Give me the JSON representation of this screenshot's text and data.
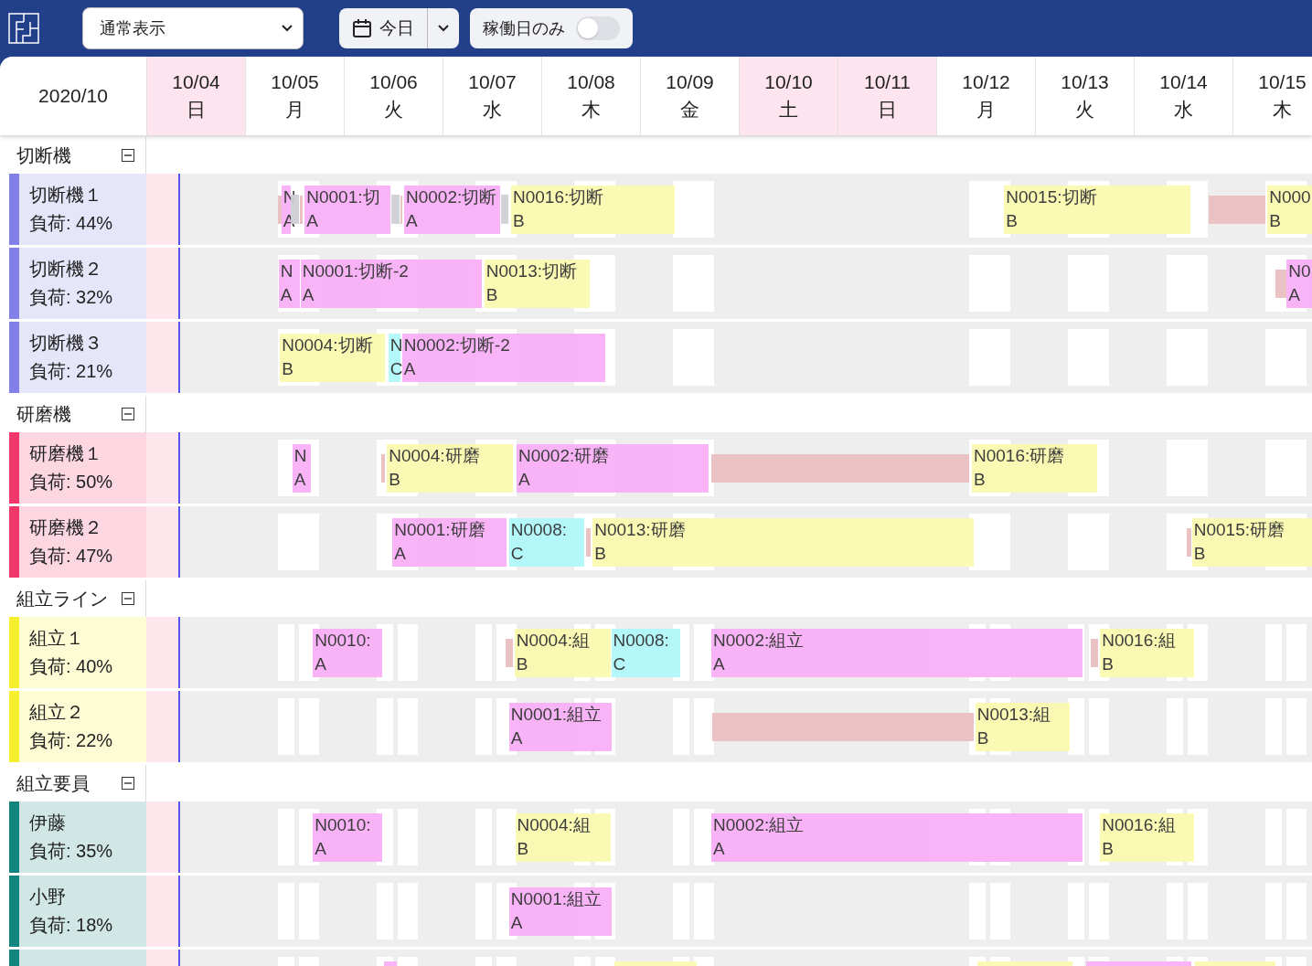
{
  "toolbar": {
    "view_select": {
      "value": "通常表示"
    },
    "today_button": {
      "label": "今日"
    },
    "workdays_toggle": {
      "label": "稼働日のみ",
      "on": false
    }
  },
  "timeline": {
    "month": "2020/10",
    "days": [
      {
        "date": "10/04",
        "weekday": "日",
        "holiday": true
      },
      {
        "date": "10/05",
        "weekday": "月",
        "holiday": false
      },
      {
        "date": "10/06",
        "weekday": "火",
        "holiday": false
      },
      {
        "date": "10/07",
        "weekday": "水",
        "holiday": false
      },
      {
        "date": "10/08",
        "weekday": "木",
        "holiday": false
      },
      {
        "date": "10/09",
        "weekday": "金",
        "holiday": false
      },
      {
        "date": "10/10",
        "weekday": "土",
        "holiday": true
      },
      {
        "date": "10/11",
        "weekday": "日",
        "holiday": true
      },
      {
        "date": "10/12",
        "weekday": "月",
        "holiday": false
      },
      {
        "date": "10/13",
        "weekday": "火",
        "holiday": false
      },
      {
        "date": "10/14",
        "weekday": "水",
        "holiday": false
      },
      {
        "date": "10/15",
        "weekday": "木",
        "holiday": false
      }
    ]
  },
  "groups": [
    {
      "name": "切断機",
      "expanded": true,
      "kind": "day",
      "color": "#8080e8",
      "resources": [
        {
          "name": "切断機１",
          "load": "負荷: 44%",
          "bars": [
            {
              "kind": "setup",
              "color": "#e9bfc0"
            },
            {
              "kind": "job",
              "label": "N",
              "category": "A",
              "color": "#f9b0f8"
            },
            {
              "kind": "wait",
              "color": "#cfcfd6"
            },
            {
              "kind": "setup",
              "color": "#e9bfc0"
            },
            {
              "kind": "job",
              "label": "N0001:切",
              "category": "A",
              "color": "#f9b0f8"
            },
            {
              "kind": "wait",
              "color": "#cfcfd6"
            },
            {
              "kind": "setup",
              "color": "#e9bfc0"
            },
            {
              "kind": "job",
              "label": "N0002:切断",
              "category": "A",
              "color": "#f9b0f8"
            },
            {
              "kind": "wait",
              "color": "#cfcfd6"
            },
            {
              "kind": "job",
              "label": "N0016:切断",
              "category": "B",
              "color": "#fafab0"
            },
            {
              "kind": "job",
              "label": "N0015:切断",
              "category": "B",
              "color": "#fafab0"
            },
            {
              "kind": "setup",
              "color": "#e9bfc0"
            },
            {
              "kind": "job",
              "label": "N000",
              "category": "B",
              "color": "#fafab0"
            }
          ]
        },
        {
          "name": "切断機２",
          "load": "負荷: 32%",
          "bars": [
            {
              "kind": "job",
              "label": "N",
              "category": "A",
              "color": "#f9b0f8"
            },
            {
              "kind": "job",
              "label": "N0001:切断-2",
              "category": "A",
              "color": "#f9b0f8"
            },
            {
              "kind": "job",
              "label": "N0013:切断",
              "category": "B",
              "color": "#fafab0"
            },
            {
              "kind": "setup",
              "color": "#e9bfc0"
            },
            {
              "kind": "job",
              "label": "N0",
              "category": "A",
              "color": "#f9b0f8"
            }
          ]
        },
        {
          "name": "切断機３",
          "load": "負荷: 21%",
          "bars": [
            {
              "kind": "job",
              "label": "N0004:切断",
              "category": "B",
              "color": "#fafab0"
            },
            {
              "kind": "job",
              "label": "N",
              "category": "C",
              "color": "#b0f8fa"
            },
            {
              "kind": "job",
              "label": "N0002:切断-2",
              "category": "A",
              "color": "#f9b0f8"
            }
          ]
        }
      ]
    },
    {
      "name": "研磨機",
      "expanded": true,
      "kind": "day",
      "color": "#f0386b",
      "resources": [
        {
          "name": "研磨機１",
          "load": "負荷: 50%",
          "bars": [
            {
              "kind": "job",
              "label": "N",
              "category": "A",
              "color": "#f9b0f8"
            },
            {
              "kind": "setup",
              "color": "#e9bfc0"
            },
            {
              "kind": "job",
              "label": "N0004:研磨",
              "category": "B",
              "color": "#fafab0"
            },
            {
              "kind": "job",
              "label": "N0002:研磨",
              "category": "A",
              "color": "#f9b0f8"
            },
            {
              "kind": "setup",
              "color": "#e9bfc0"
            },
            {
              "kind": "job",
              "label": "N0016:研磨",
              "category": "B",
              "color": "#fafab0"
            }
          ]
        },
        {
          "name": "研磨機２",
          "load": "負荷: 47%",
          "bars": [
            {
              "kind": "job",
              "label": "N0001:研磨",
              "category": "A",
              "color": "#f9b0f8"
            },
            {
              "kind": "job",
              "label": "N0008:",
              "category": "C",
              "color": "#b0f8fa"
            },
            {
              "kind": "setup",
              "color": "#e9bfc0"
            },
            {
              "kind": "job",
              "label": "N0013:研磨",
              "category": "B",
              "color": "#fafab0"
            },
            {
              "kind": "setup",
              "color": "#e9bfc0"
            },
            {
              "kind": "job",
              "label": "N0015:研磨",
              "category": "B",
              "color": "#fafab0"
            }
          ]
        }
      ]
    },
    {
      "name": "組立ライン",
      "expanded": true,
      "kind": "shift",
      "color": "#f5ef2e",
      "resources": [
        {
          "name": "組立１",
          "load": "負荷: 40%",
          "bars": [
            {
              "kind": "job",
              "label": "N0010:",
              "category": "A",
              "color": "#f9b0f8"
            },
            {
              "kind": "setup",
              "color": "#e9bfc0"
            },
            {
              "kind": "job",
              "label": "N0004:組",
              "category": "B",
              "color": "#fafab0"
            },
            {
              "kind": "job",
              "label": "N0008:",
              "category": "C",
              "color": "#b0f8fa"
            },
            {
              "kind": "job",
              "label": "N0002:組立",
              "category": "A",
              "color": "#f9b0f8"
            },
            {
              "kind": "setup",
              "color": "#e9bfc0"
            },
            {
              "kind": "job",
              "label": "N0016:組",
              "category": "B",
              "color": "#fafab0"
            }
          ]
        },
        {
          "name": "組立２",
          "load": "負荷: 22%",
          "bars": [
            {
              "kind": "job",
              "label": "N0001:組立",
              "category": "A",
              "color": "#f9b0f8"
            },
            {
              "kind": "setup",
              "color": "#e9bfc0"
            },
            {
              "kind": "job",
              "label": "N0013:組",
              "category": "B",
              "color": "#fafab0"
            }
          ]
        }
      ]
    },
    {
      "name": "組立要員",
      "expanded": true,
      "kind": "shift",
      "color": "#12857c",
      "resources": [
        {
          "name": "伊藤",
          "load": "負荷: 35%",
          "bars": [
            {
              "kind": "job",
              "label": "N0010:",
              "category": "A",
              "color": "#f9b0f8"
            },
            {
              "kind": "job",
              "label": "N0004:組",
              "category": "B",
              "color": "#fafab0"
            },
            {
              "kind": "job",
              "label": "N0002:組立",
              "category": "A",
              "color": "#f9b0f8"
            },
            {
              "kind": "job",
              "label": "N0016:組",
              "category": "B",
              "color": "#fafab0"
            }
          ]
        },
        {
          "name": "小野",
          "load": "負荷: 18%",
          "bars": [
            {
              "kind": "job",
              "label": "N0001:組立",
              "category": "A",
              "color": "#f9b0f8"
            }
          ]
        },
        {
          "bars": [
            {
              "kind": "job",
              "color": "#f9b0f8"
            },
            {
              "kind": "job",
              "color": "#fafab0"
            },
            {
              "kind": "job",
              "color": "#fafab0"
            },
            {
              "kind": "job",
              "color": "#f9b0f8"
            },
            {
              "kind": "job",
              "color": "#fafab0"
            }
          ]
        }
      ]
    }
  ]
}
